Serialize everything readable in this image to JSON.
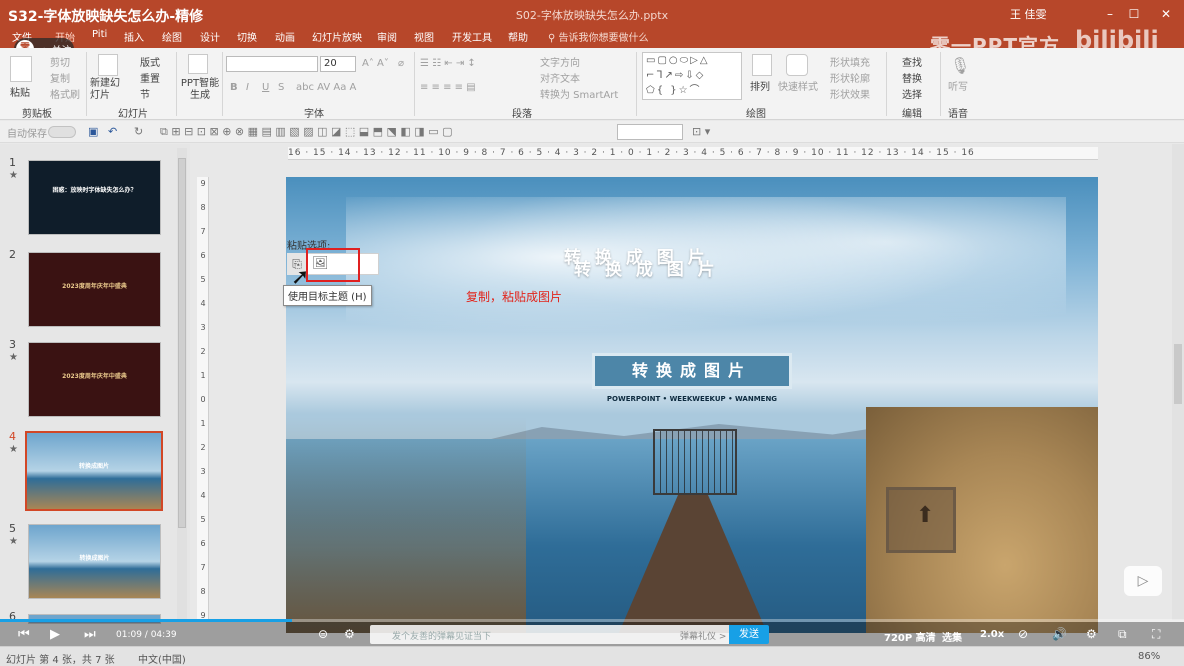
{
  "titlebar": {
    "video_title": "S32-字体放映缺失怎么办-精修",
    "doc_title": "S02-字体放映缺失怎么办.pptx",
    "user": "王 佳雯",
    "watermark": "零一PPT官方",
    "brand_mark": "bilibili"
  },
  "follow": {
    "label": "关注"
  },
  "tabs": [
    "文件",
    "开始",
    "Piti",
    "插入",
    "绘图",
    "设计",
    "切换",
    "动画",
    "幻灯片放映",
    "审阅",
    "视图",
    "开发工具",
    "帮助"
  ],
  "tell_me": "告诉我你想要做什么",
  "ribbon": {
    "groups": [
      "剪贴板",
      "幻灯片",
      "字体",
      "段落",
      "绘图",
      "编辑",
      "语音"
    ],
    "paste": "粘贴",
    "cut": "剪切",
    "copy": "复制",
    "format_painter": "格式刷",
    "new_slide": "新建幻灯片",
    "layout": "版式",
    "reset": "重置",
    "section": "节",
    "ppt_gen": "PPT智能生成",
    "font_size": "20",
    "bold": "B",
    "italic": "I",
    "underline": "U",
    "strike": "S",
    "text_direction": "文字方向",
    "align_text": "对齐文本",
    "smartart": "转换为 SmartArt",
    "arrange": "排列",
    "quick_styles": "快速样式",
    "shape_fill": "形状填充",
    "shape_outline": "形状轮廓",
    "shape_effects": "形状效果",
    "find": "查找",
    "replace": "替换",
    "select": "选择",
    "dictate": "听写"
  },
  "qat": {
    "autosave": "自动保存"
  },
  "thumbnails": [
    {
      "num": "1",
      "title": "困惑：放映时字体缺失怎么办？",
      "bg": "#0f1d2a"
    },
    {
      "num": "2",
      "title": "2023度周年庆年中盛典",
      "bg": "#3a1212"
    },
    {
      "num": "3",
      "title": "2023度周年庆年中盛典",
      "bg": "#3a1212"
    },
    {
      "num": "4",
      "title": "转换成图片",
      "bg": "#6ea5cd",
      "selected": true
    },
    {
      "num": "5",
      "title": "转换成图片",
      "bg": "#6ea5cd"
    },
    {
      "num": "6",
      "title": "",
      "bg": "#6ea5cd"
    }
  ],
  "ruler": {
    "h": "16 · 15 · 14 · 13 · 12 · 11 · 10 · 9 · 8 · 7 · 6 · 5 · 4 · 3 · 2 · 1 · 0 · 1 · 2 · 3 · 4 · 5 · 6 · 7 · 8 · 9 · 10 · 11 · 12 · 13 · 14 · 15 · 16",
    "v": [
      "9",
      "8",
      "7",
      "6",
      "5",
      "4",
      "3",
      "2",
      "1",
      "0",
      "1",
      "2",
      "3",
      "4",
      "5",
      "6",
      "7",
      "8",
      "9"
    ]
  },
  "slide": {
    "title_ghost": "转 换 成 图 片",
    "title_ghost2": "转 换 成 图 片",
    "banner": "转换成图片",
    "subtitle": "POWERPOINT • WEEKWEEKUP • WANMENG"
  },
  "paste_popup": {
    "label": "粘贴选项:",
    "tooltip": "使用目标主题 (H)"
  },
  "annotation": "复制，粘贴成图片",
  "statusbar": {
    "slide_info": "幻灯片 第 4 张，共 7 张",
    "language": "中文(中国)",
    "zoom": "86%"
  },
  "player": {
    "time": "01:09 / 04:39",
    "progress": 0.247,
    "danmaku_placeholder": "发个友善的弹幕见证当下",
    "etiquette": "弹幕礼仪 >",
    "send": "发送",
    "quality": "720P 高清",
    "episodes": "选集",
    "speed": "2.0x"
  },
  "colors": {
    "ribbon_accent": "#b7472a",
    "selection": "#d24726",
    "annotation": "#e2241b",
    "player_accent": "#17a0e6"
  }
}
